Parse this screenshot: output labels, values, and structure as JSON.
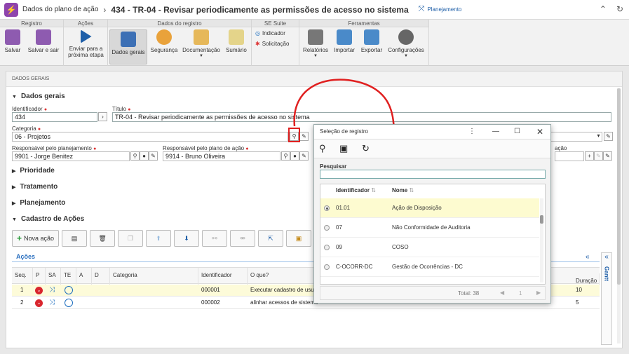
{
  "header": {
    "app_title": "Dados do plano de ação",
    "record_title": "434 - TR-04 - Revisar periodicamente as permissões de acesso no sistema",
    "planning_link": "Planejamento"
  },
  "ribbon": {
    "groups": {
      "registro": "Registro",
      "acoes": "Ações",
      "dados": "Dados do registro",
      "suite": "SE Suite",
      "ferramentas": "Ferramentas"
    },
    "buttons": {
      "salvar": "Salvar",
      "salvar_sair": "Salvar e sair",
      "enviar": "Enviar para a próxima etapa",
      "dados_gerais": "Dados gerais",
      "seguranca": "Segurança",
      "documentacao": "Documentação",
      "sumario": "Sumário",
      "indicador": "Indicador",
      "solicitacao": "Solicitação",
      "relatorios": "Relatórios",
      "importar": "Importar",
      "exportar": "Exportar",
      "configuracoes": "Configurações"
    }
  },
  "form": {
    "panel_title": "DADOS GERAIS",
    "section_dados": "Dados gerais",
    "identificador_label": "Identificador",
    "identificador_value": "434",
    "titulo_label": "Título",
    "titulo_value": "TR-04 - Revisar periodicamente as permissões de acesso no sistema",
    "categoria_label": "Categoria",
    "categoria_value": "06 - Projetos",
    "resp_planejamento_label": "Responsável pelo planejamento",
    "resp_planejamento_value": "9901 - Jorge Benitez",
    "resp_plano_label": "Responsável pelo plano de ação",
    "resp_plano_value": "9914 - Bruno Oliveira",
    "partial_label": "ação",
    "sections": [
      "Prioridade",
      "Tratamento",
      "Planejamento",
      "Cadastro de Ações"
    ]
  },
  "actions_toolbar": {
    "nova_acao": "Nova ação"
  },
  "grid": {
    "title": "Ações",
    "headers": [
      "Seq.",
      "P",
      "SA",
      "TE",
      "A",
      "D",
      "Categoria",
      "Identificador",
      "O que?",
      "Duração"
    ],
    "rows": [
      {
        "seq": "1",
        "identificador": "000001",
        "oque": "Executar cadastro de usu...",
        "duracao": "10"
      },
      {
        "seq": "2",
        "identificador": "000002",
        "oque": "alinhar acessos de sistema",
        "duracao": "5"
      }
    ],
    "gantt_label": "Gantt"
  },
  "dialog": {
    "title": "Seleção de registro",
    "search_label": "Pesquisar",
    "search_value": "",
    "col_identificador": "Identificador",
    "col_nome": "Nome",
    "rows": [
      {
        "id": "01.01",
        "nome": "Ação de Disposição"
      },
      {
        "id": "07",
        "nome": "Não Conformidade de Auditoria"
      },
      {
        "id": "09",
        "nome": "COSO"
      },
      {
        "id": "C-OCORR-DC",
        "nome": "Gestão de Ocorrências - DC"
      }
    ],
    "total": "Total: 38",
    "page": "1"
  }
}
